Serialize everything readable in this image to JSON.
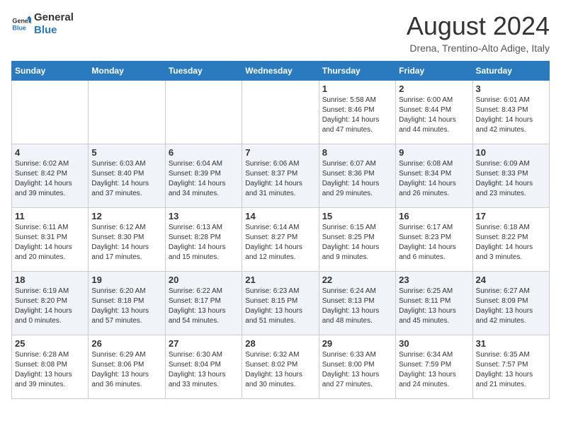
{
  "header": {
    "logo_line1": "General",
    "logo_line2": "Blue",
    "month": "August 2024",
    "location": "Drena, Trentino-Alto Adige, Italy"
  },
  "days_of_week": [
    "Sunday",
    "Monday",
    "Tuesday",
    "Wednesday",
    "Thursday",
    "Friday",
    "Saturday"
  ],
  "weeks": [
    [
      {
        "day": "",
        "info": ""
      },
      {
        "day": "",
        "info": ""
      },
      {
        "day": "",
        "info": ""
      },
      {
        "day": "",
        "info": ""
      },
      {
        "day": "1",
        "info": "Sunrise: 5:58 AM\nSunset: 8:46 PM\nDaylight: 14 hours and 47 minutes."
      },
      {
        "day": "2",
        "info": "Sunrise: 6:00 AM\nSunset: 8:44 PM\nDaylight: 14 hours and 44 minutes."
      },
      {
        "day": "3",
        "info": "Sunrise: 6:01 AM\nSunset: 8:43 PM\nDaylight: 14 hours and 42 minutes."
      }
    ],
    [
      {
        "day": "4",
        "info": "Sunrise: 6:02 AM\nSunset: 8:42 PM\nDaylight: 14 hours and 39 minutes."
      },
      {
        "day": "5",
        "info": "Sunrise: 6:03 AM\nSunset: 8:40 PM\nDaylight: 14 hours and 37 minutes."
      },
      {
        "day": "6",
        "info": "Sunrise: 6:04 AM\nSunset: 8:39 PM\nDaylight: 14 hours and 34 minutes."
      },
      {
        "day": "7",
        "info": "Sunrise: 6:06 AM\nSunset: 8:37 PM\nDaylight: 14 hours and 31 minutes."
      },
      {
        "day": "8",
        "info": "Sunrise: 6:07 AM\nSunset: 8:36 PM\nDaylight: 14 hours and 29 minutes."
      },
      {
        "day": "9",
        "info": "Sunrise: 6:08 AM\nSunset: 8:34 PM\nDaylight: 14 hours and 26 minutes."
      },
      {
        "day": "10",
        "info": "Sunrise: 6:09 AM\nSunset: 8:33 PM\nDaylight: 14 hours and 23 minutes."
      }
    ],
    [
      {
        "day": "11",
        "info": "Sunrise: 6:11 AM\nSunset: 8:31 PM\nDaylight: 14 hours and 20 minutes."
      },
      {
        "day": "12",
        "info": "Sunrise: 6:12 AM\nSunset: 8:30 PM\nDaylight: 14 hours and 17 minutes."
      },
      {
        "day": "13",
        "info": "Sunrise: 6:13 AM\nSunset: 8:28 PM\nDaylight: 14 hours and 15 minutes."
      },
      {
        "day": "14",
        "info": "Sunrise: 6:14 AM\nSunset: 8:27 PM\nDaylight: 14 hours and 12 minutes."
      },
      {
        "day": "15",
        "info": "Sunrise: 6:15 AM\nSunset: 8:25 PM\nDaylight: 14 hours and 9 minutes."
      },
      {
        "day": "16",
        "info": "Sunrise: 6:17 AM\nSunset: 8:23 PM\nDaylight: 14 hours and 6 minutes."
      },
      {
        "day": "17",
        "info": "Sunrise: 6:18 AM\nSunset: 8:22 PM\nDaylight: 14 hours and 3 minutes."
      }
    ],
    [
      {
        "day": "18",
        "info": "Sunrise: 6:19 AM\nSunset: 8:20 PM\nDaylight: 14 hours and 0 minutes."
      },
      {
        "day": "19",
        "info": "Sunrise: 6:20 AM\nSunset: 8:18 PM\nDaylight: 13 hours and 57 minutes."
      },
      {
        "day": "20",
        "info": "Sunrise: 6:22 AM\nSunset: 8:17 PM\nDaylight: 13 hours and 54 minutes."
      },
      {
        "day": "21",
        "info": "Sunrise: 6:23 AM\nSunset: 8:15 PM\nDaylight: 13 hours and 51 minutes."
      },
      {
        "day": "22",
        "info": "Sunrise: 6:24 AM\nSunset: 8:13 PM\nDaylight: 13 hours and 48 minutes."
      },
      {
        "day": "23",
        "info": "Sunrise: 6:25 AM\nSunset: 8:11 PM\nDaylight: 13 hours and 45 minutes."
      },
      {
        "day": "24",
        "info": "Sunrise: 6:27 AM\nSunset: 8:09 PM\nDaylight: 13 hours and 42 minutes."
      }
    ],
    [
      {
        "day": "25",
        "info": "Sunrise: 6:28 AM\nSunset: 8:08 PM\nDaylight: 13 hours and 39 minutes."
      },
      {
        "day": "26",
        "info": "Sunrise: 6:29 AM\nSunset: 8:06 PM\nDaylight: 13 hours and 36 minutes."
      },
      {
        "day": "27",
        "info": "Sunrise: 6:30 AM\nSunset: 8:04 PM\nDaylight: 13 hours and 33 minutes."
      },
      {
        "day": "28",
        "info": "Sunrise: 6:32 AM\nSunset: 8:02 PM\nDaylight: 13 hours and 30 minutes."
      },
      {
        "day": "29",
        "info": "Sunrise: 6:33 AM\nSunset: 8:00 PM\nDaylight: 13 hours and 27 minutes."
      },
      {
        "day": "30",
        "info": "Sunrise: 6:34 AM\nSunset: 7:59 PM\nDaylight: 13 hours and 24 minutes."
      },
      {
        "day": "31",
        "info": "Sunrise: 6:35 AM\nSunset: 7:57 PM\nDaylight: 13 hours and 21 minutes."
      }
    ]
  ]
}
